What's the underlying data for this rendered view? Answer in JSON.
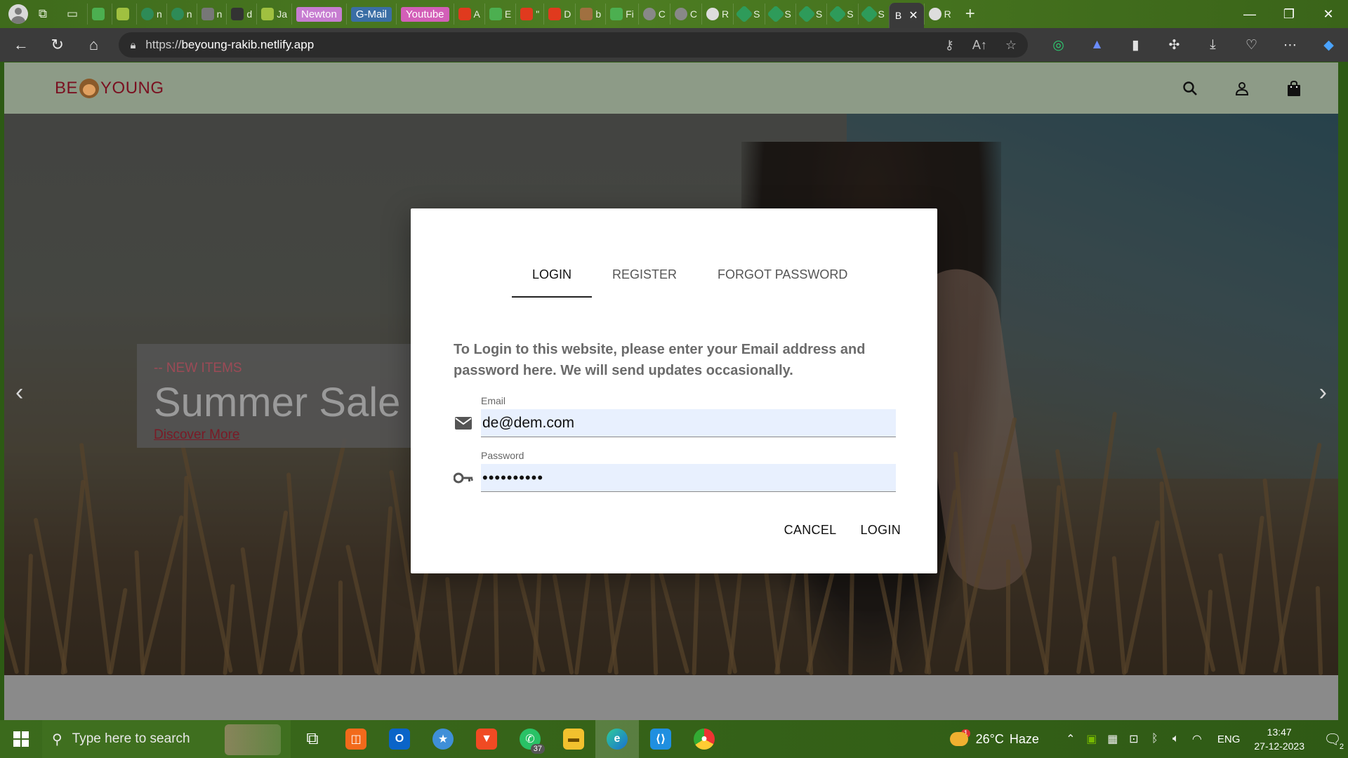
{
  "browser": {
    "tab_labels": [
      "n",
      "n",
      "n",
      "d",
      "Ja",
      "A",
      "E",
      "\"",
      "D",
      "b",
      "Fi",
      "C",
      "C",
      "R",
      "S",
      "S",
      "S",
      "S",
      "S",
      "R"
    ],
    "pill_tabs": [
      {
        "label": "Newton",
        "color": "#c77dd1"
      },
      {
        "label": "G-Mail",
        "color": "#3a6ea5"
      },
      {
        "label": "Youtube",
        "color": "#d35fb8"
      }
    ],
    "active_tab": {
      "label": "B",
      "close": "✕"
    },
    "new_tab": "+",
    "window_controls": {
      "minimize": "—",
      "restore": "❐",
      "close": "✕"
    },
    "url": {
      "scheme": "https://",
      "host": "beyoung-rakib.netlify.app"
    }
  },
  "site": {
    "logo_left": "BE",
    "logo_right": "YOUNG",
    "header_icons": [
      "search-icon",
      "account-icon",
      "shopping-bag-icon"
    ]
  },
  "hero": {
    "kicker": "-- NEW ITEMS",
    "title": "Summer Sale",
    "cta": "Discover More",
    "prev": "‹",
    "next": "›"
  },
  "modal": {
    "tabs": [
      {
        "label": "LOGIN",
        "active": true
      },
      {
        "label": "REGISTER",
        "active": false
      },
      {
        "label": "FORGOT PASSWORD",
        "active": false
      }
    ],
    "message": "To Login to this website, please enter your Email address and password here. We will send updates occasionally.",
    "email": {
      "label": "Email",
      "value": "de@dem.com"
    },
    "password": {
      "label": "Password",
      "value": "••••••••••"
    },
    "cancel_label": "CANCEL",
    "login_label": "LOGIN"
  },
  "taskbar": {
    "search_placeholder": "Type here to search",
    "whatsapp_badge": "37",
    "weather": {
      "badge": "1",
      "temp": "26°C",
      "condition": "Haze"
    },
    "language": "ENG",
    "time": "13:47",
    "date": "27-12-2023",
    "notifications": "2"
  },
  "colors": {
    "logo": "#7a1020",
    "header_bg": "#8d9b87",
    "input_bg": "#e8f0fe",
    "kicker": "#9c4a56",
    "cta": "#7a1a26"
  }
}
